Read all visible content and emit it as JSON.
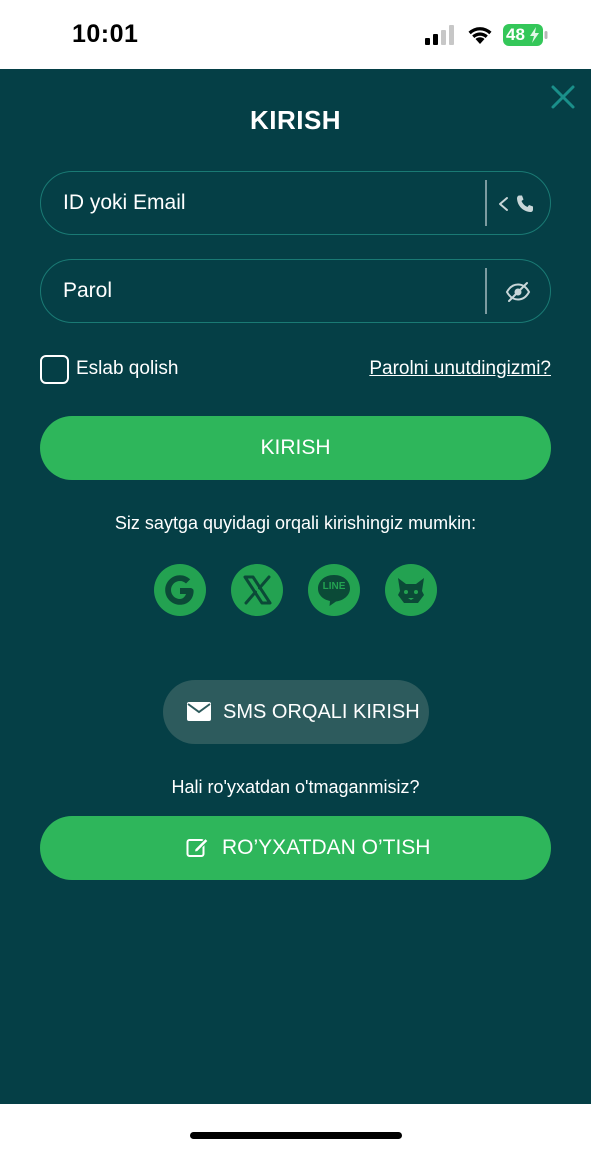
{
  "status_bar": {
    "time": "10:01",
    "battery": "48",
    "icons": [
      "signal-icon",
      "wifi-icon",
      "battery-charging-icon"
    ]
  },
  "colors": {
    "background": "#053f46",
    "primary": "#2eb65b",
    "social": "#23a251",
    "secondary_button": "#2d5b5d",
    "field_border": "#1a7a74"
  },
  "header": {
    "title": "KIRISH",
    "close_icon": "close-icon"
  },
  "form": {
    "id_placeholder": "ID yoki Email",
    "id_toggle_icons": [
      "chevron-left-icon",
      "phone-icon"
    ],
    "password_placeholder": "Parol",
    "password_toggle_icon": "eye-off-icon",
    "remember_label": "Eslab qolish",
    "remember_checked": false,
    "forgot_link": "Parolni unutdingizmi?",
    "submit_label": "KIRISH"
  },
  "social": {
    "caption": "Siz saytga quyidagi orqali kirishingiz mumkin:",
    "providers": [
      {
        "name": "Google",
        "icon": "google-icon"
      },
      {
        "name": "X",
        "icon": "x-icon"
      },
      {
        "name": "LINE",
        "icon": "line-icon"
      },
      {
        "name": "MetaMask",
        "icon": "fox-icon"
      }
    ],
    "line_label": "LINE"
  },
  "sms": {
    "label": "SMS ORQALI KIRISH",
    "icon": "envelope-icon"
  },
  "register": {
    "caption": "Hali ro'yxatdan o'tmaganmisiz?",
    "label": "RO’YXATDAN O’TISH",
    "icon": "edit-icon"
  }
}
